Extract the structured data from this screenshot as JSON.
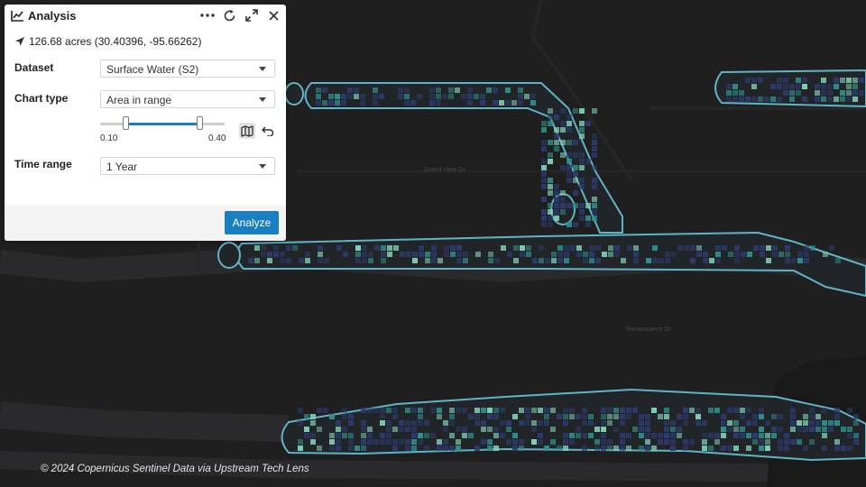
{
  "panel": {
    "title": "Analysis",
    "area_text": "126.68 acres (30.40396, -95.66262)",
    "dataset": {
      "label": "Dataset",
      "value": "Surface Water (S2)"
    },
    "chart_type": {
      "label": "Chart type",
      "value": "Area in range"
    },
    "range_slider": {
      "min_label": "0.10",
      "max_label": "0.40",
      "low": 0.1,
      "high": 0.4
    },
    "time_range": {
      "label": "Time range",
      "value": "1 Year"
    },
    "analyze_label": "Analyze",
    "icons": {
      "title_icon": "line-chart-icon",
      "more": "more-icon",
      "refresh": "refresh-icon",
      "expand": "expand-icon",
      "close": "close-icon",
      "location": "location-arrow-icon",
      "map_toggle": "map-icon",
      "undo": "undo-icon"
    }
  },
  "map": {
    "street_labels": [
      "Grand View Dr",
      "Renaissance Dr"
    ],
    "colors": {
      "background": "#1f1f20",
      "water_outline": "#5fb4c8",
      "pixel_dark": "#2d3a6e",
      "pixel_teal": "#2f8f8c",
      "pixel_light": "#7fcfb6"
    }
  },
  "attribution": "© 2024 Copernicus Sentinel Data via Upstream Tech Lens",
  "colors": {
    "accent": "#1a7fc1"
  }
}
